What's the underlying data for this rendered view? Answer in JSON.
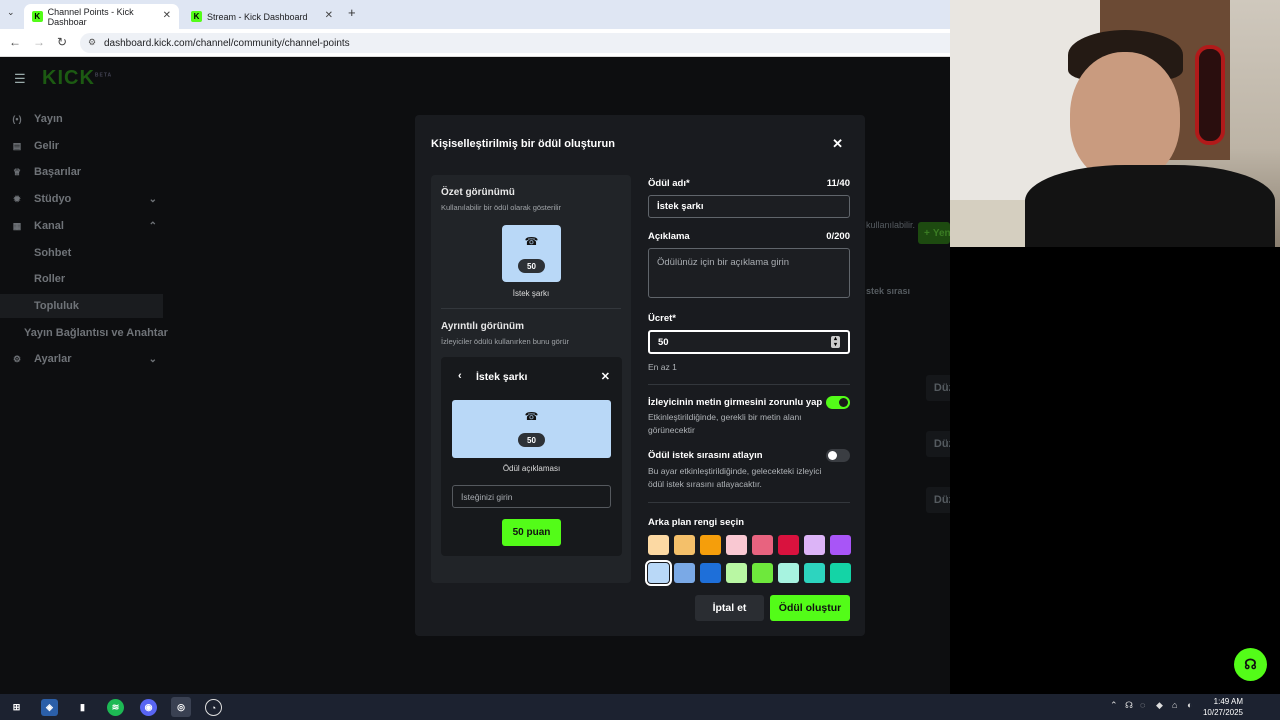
{
  "browser": {
    "tabs": [
      {
        "title": "Channel Points - Kick Dashboar",
        "active": true
      },
      {
        "title": "Stream - Kick Dashboard",
        "active": false
      }
    ],
    "url": "dashboard.kick.com/channel/community/channel-points"
  },
  "sidebar": {
    "logo": "KICK",
    "logo_badge": "BETA",
    "items": [
      {
        "label": "Yayın",
        "icon": "broadcast-icon"
      },
      {
        "label": "Gelir",
        "icon": "revenue-icon"
      },
      {
        "label": "Başarılar",
        "icon": "trophy-icon"
      },
      {
        "label": "Stüdyo",
        "icon": "studio-icon"
      },
      {
        "label": "Kanal",
        "icon": "channel-icon"
      },
      {
        "label": "Sohbet"
      },
      {
        "label": "Roller"
      },
      {
        "label": "Topluluk"
      },
      {
        "label": "Yayın Bağlantısı ve Anahtar"
      },
      {
        "label": "Ayarlar",
        "icon": "settings-icon"
      }
    ]
  },
  "background": {
    "ghost_note": "kullanılabilir.",
    "queue_label": "stek sırası",
    "new_button": "Yenisini oluştur",
    "edit_label": "Düzenle"
  },
  "modal": {
    "title": "Kişiselleştirilmiş bir ödül oluşturun",
    "summary_heading": "Özet görünümü",
    "summary_sub": "Kullanılabilir bir ödül olarak gösterilir",
    "tile_cost": "50",
    "tile_name": "İstek şarkı",
    "detail_heading": "Ayrıntılı görünüm",
    "detail_sub": "İzleyiciler ödülü kullanırken bunu görür",
    "card_title": "İstek şarkı",
    "card_cost": "50",
    "card_desc": "Ödül açıklaması",
    "card_input_placeholder": "İsteğinizi girin",
    "card_button": "50 puan",
    "reward_name_label": "Ödül adı*",
    "reward_name_count": "11/40",
    "reward_name_value": "İstek şarkı",
    "description_label": "Açıklama",
    "description_count": "0/200",
    "description_placeholder": "Ödülünüz için bir açıklama girin",
    "cost_label": "Ücret*",
    "cost_value": "50",
    "cost_hint": "En az 1",
    "toggle1_label": "İzleyicinin metin girmesini zorunlu yap",
    "toggle1_desc": "Etkinleştirildiğinde, gerekli bir metin alanı görünecektir",
    "toggle1_on": true,
    "toggle2_label": "Ödül istek sırasını atlayın",
    "toggle2_desc": "Bu ayar etkinleştirildiğinde, gelecekteki izleyici ödül istek sırasını atlayacaktır.",
    "toggle2_on": false,
    "color_label": "Arka plan rengi seçin",
    "colors_row1": [
      "#fcd9a3",
      "#f4c06a",
      "#f59e0b",
      "#f9c8d2",
      "#e8637f",
      "#d9123e",
      "#dcb4f7",
      "#a855f7"
    ],
    "colors_row2": [
      "#b9d8f7",
      "#7aa9e6",
      "#1e6fd9",
      "#b9f7a3",
      "#6ee83c",
      "#a7f3e0",
      "#2dd4bf",
      "#14d4a6"
    ],
    "selected_color": "#b9d8f7",
    "cancel": "İptal et",
    "create": "Ödül oluştur"
  },
  "accent": "#53fc18",
  "taskbar": {
    "time": "1:49 AM",
    "date": "10/27/2025"
  }
}
